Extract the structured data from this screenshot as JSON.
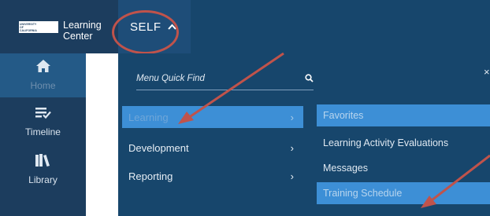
{
  "header": {
    "logo": {
      "lines": [
        "UNIVERSITY",
        "OF",
        "CALIFORNIA"
      ]
    },
    "brand_line1": "Learning",
    "brand_line2": "Center",
    "self_label": "SELF",
    "self_icon": "chevron-up-icon"
  },
  "sidebar": {
    "items": [
      {
        "label": "Home",
        "icon": "home-icon",
        "active": true
      },
      {
        "label": "Timeline",
        "icon": "timeline-icon",
        "active": false
      },
      {
        "label": "Library",
        "icon": "library-icon",
        "active": false
      }
    ]
  },
  "menu": {
    "quick_find_placeholder": "Menu Quick Find",
    "search_icon": "search-icon",
    "close_label": "×",
    "categories": [
      {
        "label": "Learning",
        "active": true
      },
      {
        "label": "Development",
        "active": false
      },
      {
        "label": "Reporting",
        "active": false
      }
    ],
    "chevron": "›",
    "submenu": [
      {
        "label": "Favorites",
        "active": true
      },
      {
        "label": "Learning Activity Evaluations",
        "active": false
      },
      {
        "label": "Messages",
        "active": false
      },
      {
        "label": "Training Schedule",
        "active": true
      }
    ]
  },
  "colors": {
    "sidebar_bg": "#1c3d5e",
    "topbar_bg": "#17466c",
    "highlight_blue": "#3d8fd6",
    "annotation_red": "#c0534b"
  }
}
